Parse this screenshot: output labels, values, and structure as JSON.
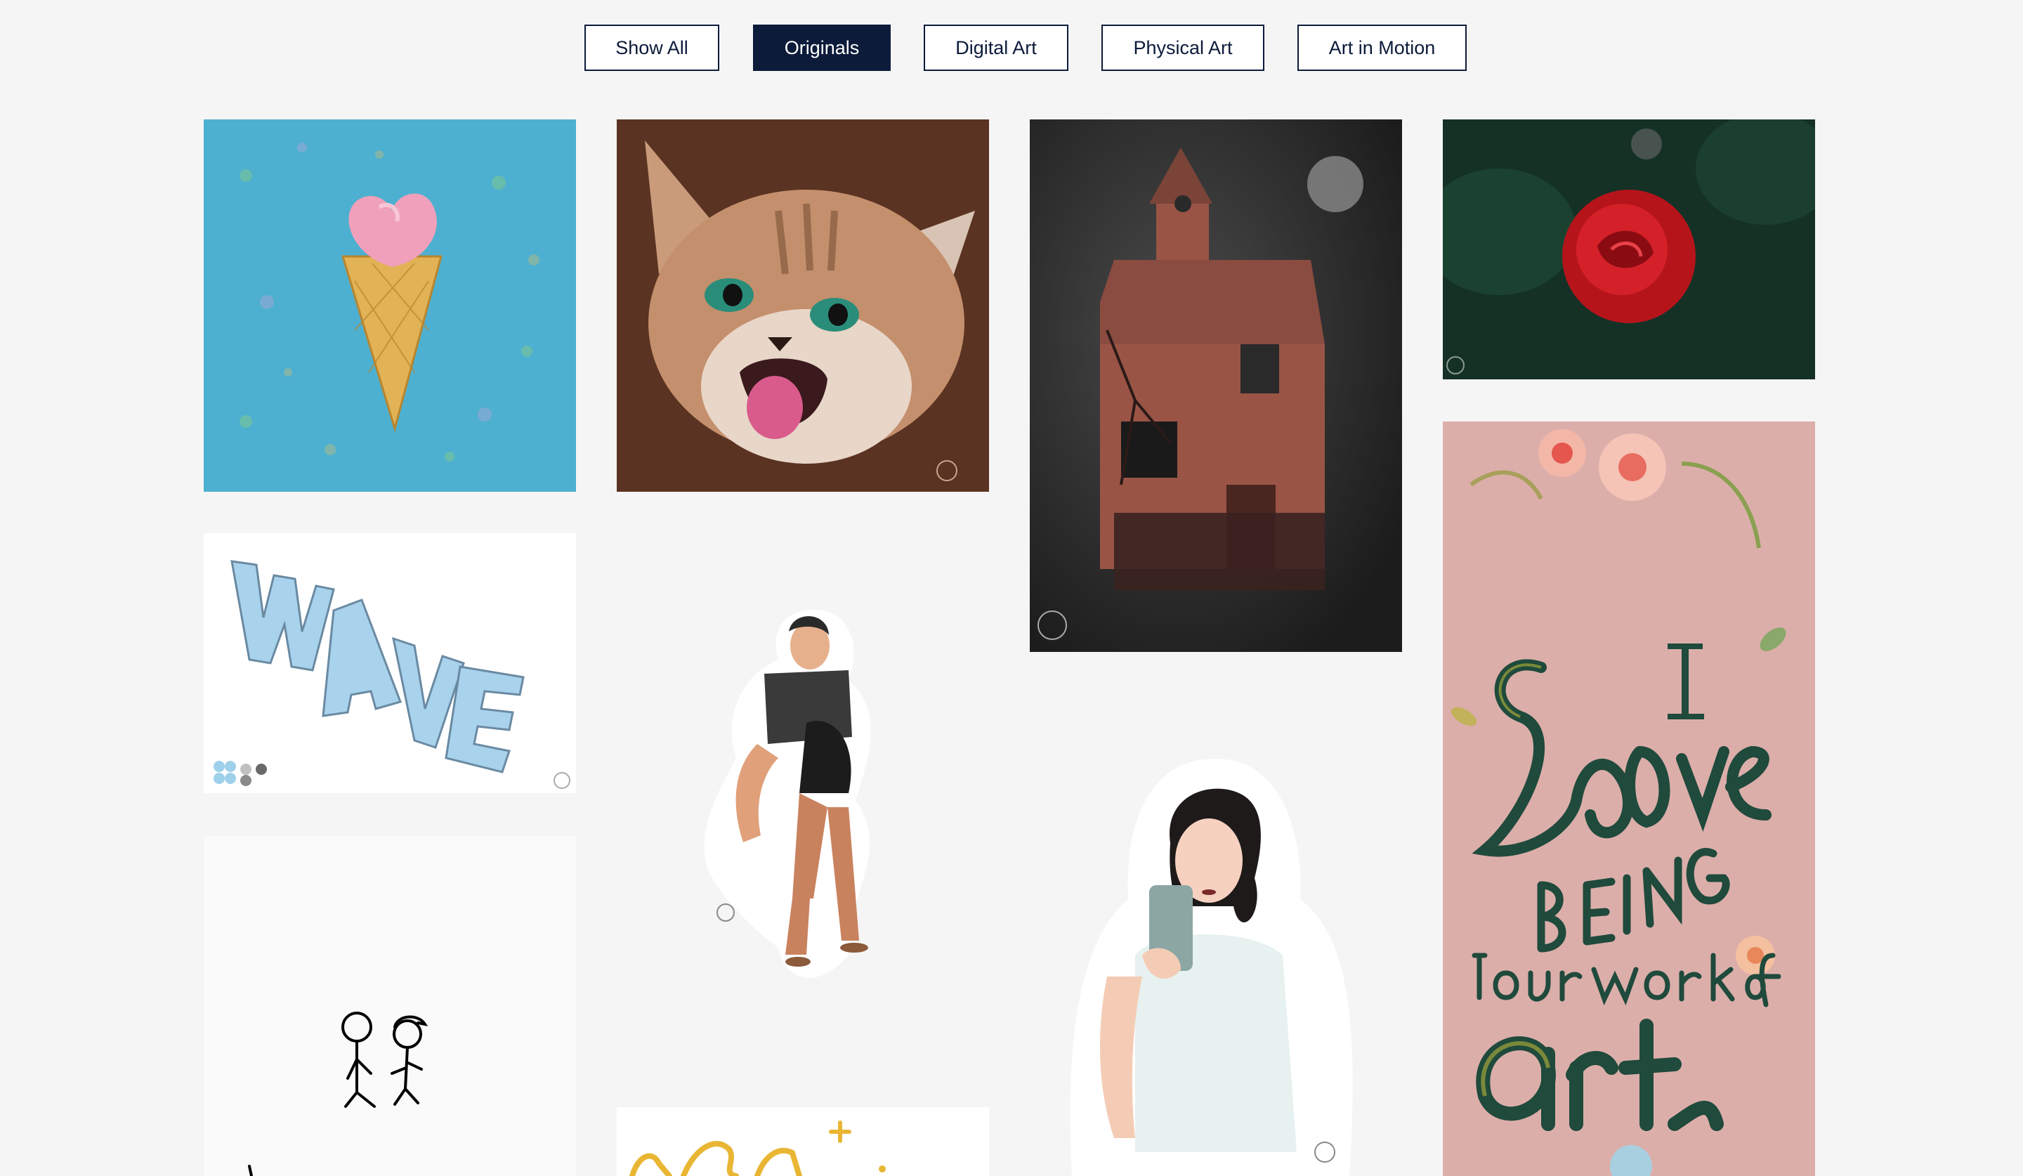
{
  "filters": [
    {
      "label": "Show All",
      "active": false
    },
    {
      "label": "Originals",
      "active": true
    },
    {
      "label": "Digital Art",
      "active": false
    },
    {
      "label": "Physical Art",
      "active": false
    },
    {
      "label": "Art in Motion",
      "active": false
    }
  ],
  "colors": {
    "page_bg": "#f5f5f5",
    "filter_border": "#0c1b3a",
    "filter_active_bg": "#0c1b3a",
    "filter_active_text": "#ffffff"
  },
  "artworks": {
    "ice_cream": {
      "icon": "ice-cream-artwork"
    },
    "kitten": {
      "icon": "kitten-artwork"
    },
    "haunted_house": {
      "icon": "haunted-house-artwork"
    },
    "rose": {
      "icon": "rose-artwork"
    },
    "wave": {
      "icon": "wave-lettering-artwork"
    },
    "couple_sticker": {
      "icon": "couple-sticker-artwork"
    },
    "mirror_selfie": {
      "icon": "mirror-selfie-artwork"
    },
    "love_lettering": {
      "icon": "love-lettering-artwork"
    },
    "stick_figures": {
      "icon": "stick-figures-artwork"
    },
    "gold_script": {
      "icon": "gold-script-artwork"
    }
  }
}
